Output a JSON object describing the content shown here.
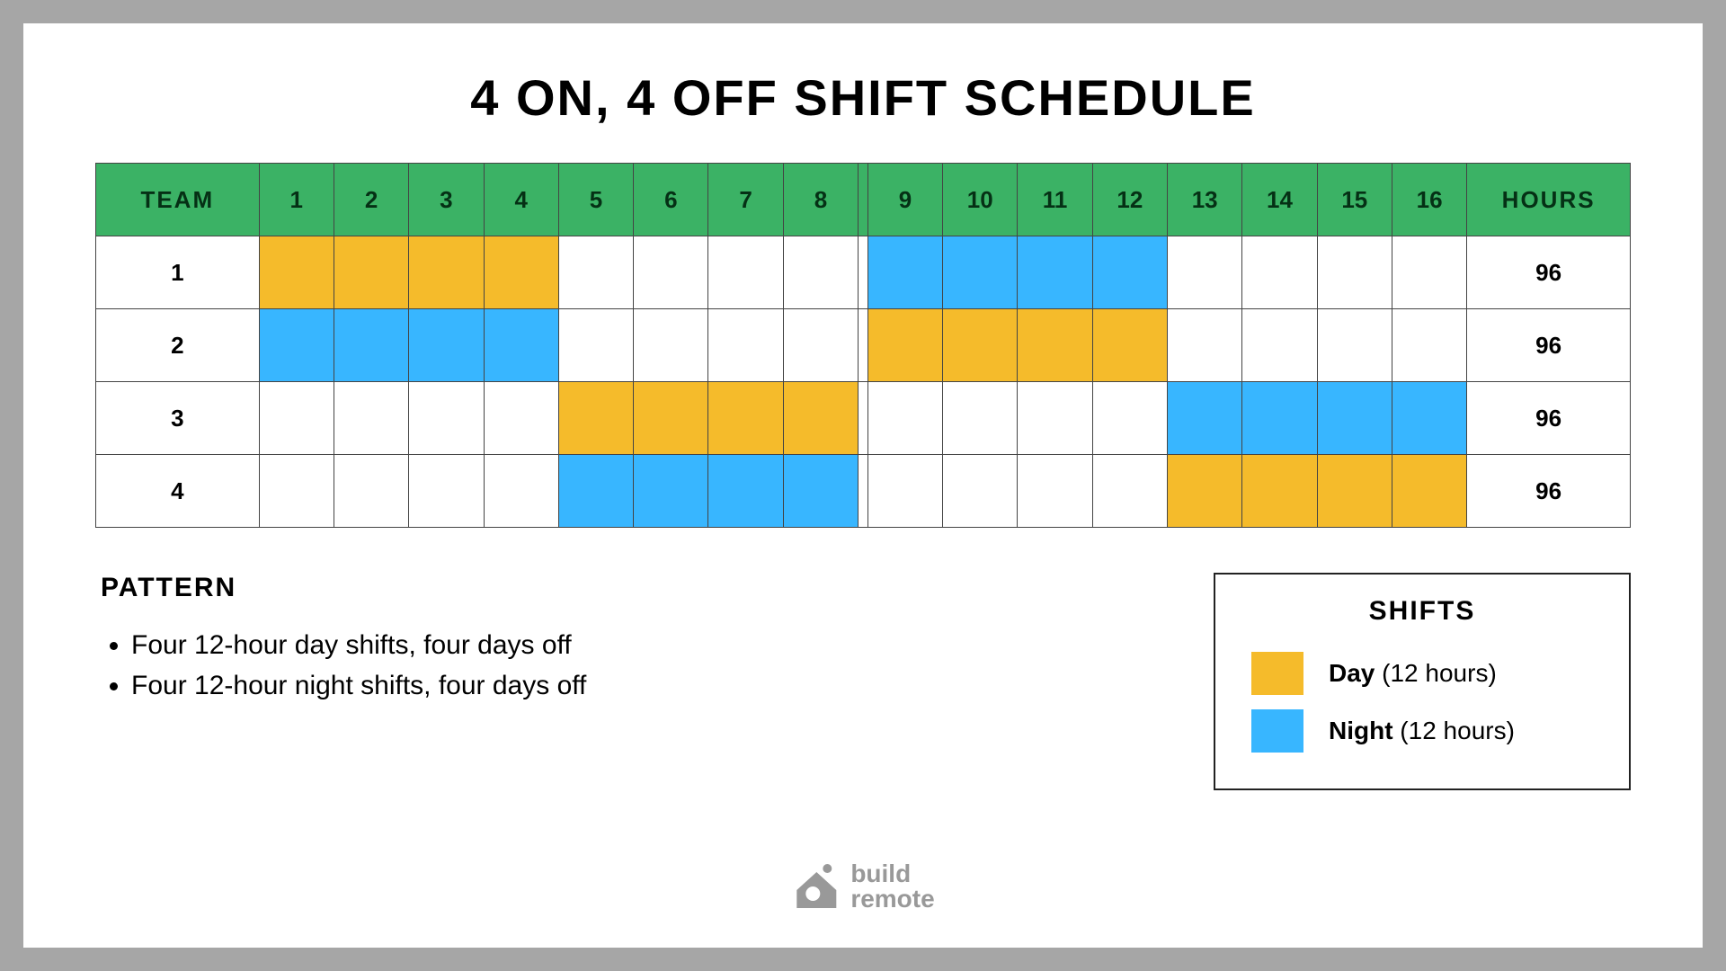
{
  "title": "4 ON, 4 OFF SHIFT SCHEDULE",
  "headers": {
    "team": "TEAM",
    "hours": "HOURS"
  },
  "days": [
    "1",
    "2",
    "3",
    "4",
    "5",
    "6",
    "7",
    "8",
    "9",
    "10",
    "11",
    "12",
    "13",
    "14",
    "15",
    "16"
  ],
  "teams": [
    {
      "name": "1",
      "hours": "96",
      "cells": [
        "day",
        "day",
        "day",
        "day",
        "off",
        "off",
        "off",
        "off",
        "night",
        "night",
        "night",
        "night",
        "off",
        "off",
        "off",
        "off"
      ]
    },
    {
      "name": "2",
      "hours": "96",
      "cells": [
        "night",
        "night",
        "night",
        "night",
        "off",
        "off",
        "off",
        "off",
        "day",
        "day",
        "day",
        "day",
        "off",
        "off",
        "off",
        "off"
      ]
    },
    {
      "name": "3",
      "hours": "96",
      "cells": [
        "off",
        "off",
        "off",
        "off",
        "day",
        "day",
        "day",
        "day",
        "off",
        "off",
        "off",
        "off",
        "night",
        "night",
        "night",
        "night"
      ]
    },
    {
      "name": "4",
      "hours": "96",
      "cells": [
        "off",
        "off",
        "off",
        "off",
        "night",
        "night",
        "night",
        "night",
        "off",
        "off",
        "off",
        "off",
        "day",
        "day",
        "day",
        "day"
      ]
    }
  ],
  "pattern": {
    "heading": "PATTERN",
    "items": [
      "Four 12-hour day shifts, four days off",
      "Four 12-hour night shifts, four days off"
    ]
  },
  "legend": {
    "heading": "SHIFTS",
    "day_bold": "Day",
    "day_rest": " (12 hours)",
    "night_bold": "Night",
    "night_rest": " (12 hours)"
  },
  "logo": {
    "line1": "build",
    "line2": "remote"
  },
  "colors": {
    "day": "#f5bb2b",
    "night": "#38b6ff",
    "header": "#3bb265"
  }
}
